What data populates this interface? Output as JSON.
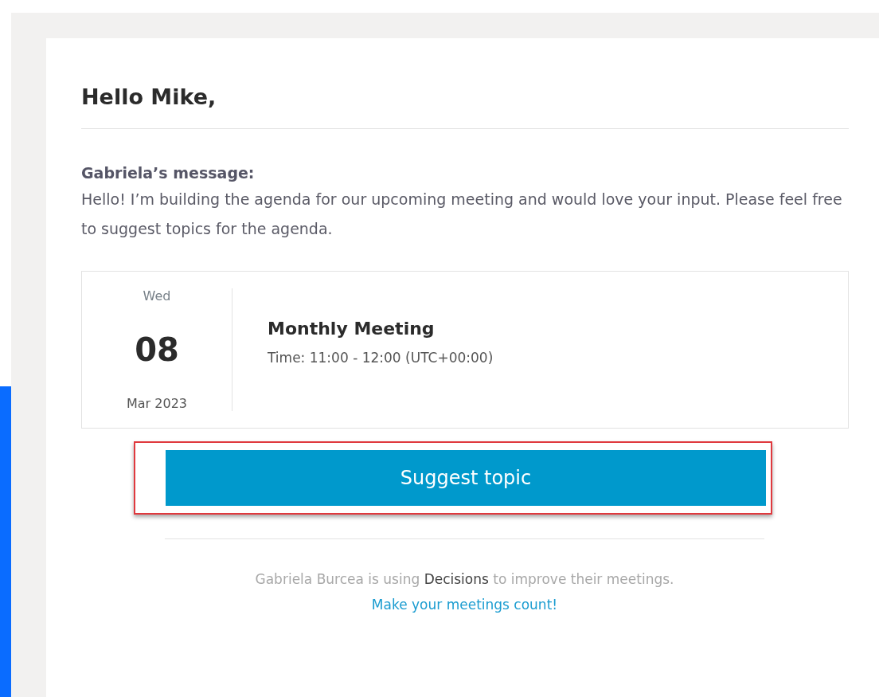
{
  "greeting": "Hello Mike,",
  "message": {
    "label": "Gabriela’s message:",
    "body": "Hello! I’m building the agenda for our upcoming meeting and would love your input. Please feel free to suggest topics for the agenda."
  },
  "event": {
    "weekday": "Wed",
    "day": "08",
    "month_year": "Mar 2023",
    "title": "Monthly Meeting",
    "time": "Time: 11:00 - 12:00 (UTC+00:00)"
  },
  "button": {
    "label": "Suggest topic",
    "highlighted": true
  },
  "footer": {
    "text": "Gabriela Burcea is using **Decisions** to improve their meetings.",
    "link": "Make your meetings count!"
  }
}
